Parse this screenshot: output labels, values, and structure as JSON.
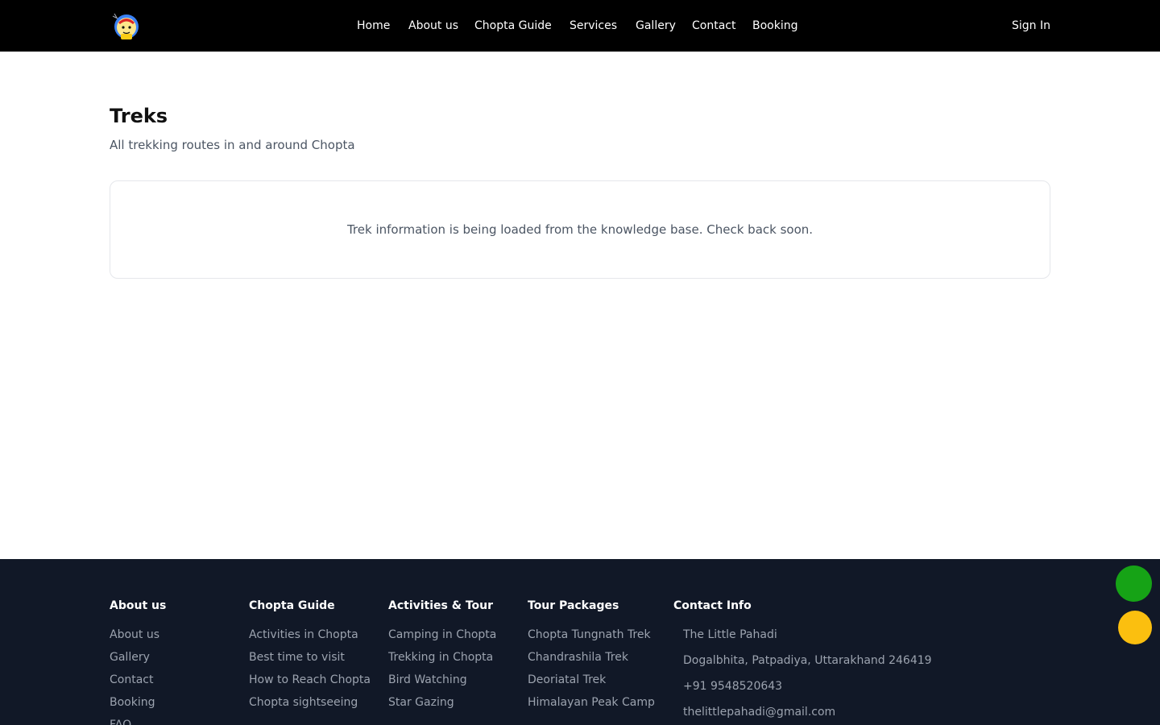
{
  "header": {
    "nav": [
      {
        "label": "Home"
      },
      {
        "label": "About us"
      },
      {
        "label": "Chopta Guide"
      },
      {
        "label": "Services"
      },
      {
        "label": "Gallery"
      },
      {
        "label": "Contact"
      },
      {
        "label": "Booking"
      }
    ],
    "signin_label": "Sign In"
  },
  "main": {
    "title": "Treks",
    "subtitle": "All trekking routes in and around Chopta",
    "notice": "Trek information is being loaded from the knowledge base. Check back soon."
  },
  "footer": {
    "columns": [
      {
        "title": "About us",
        "links": [
          "About us",
          "Gallery",
          "Contact",
          "Booking",
          "FAQ"
        ]
      },
      {
        "title": "Chopta Guide",
        "links": [
          "Activities in Chopta",
          "Best time to visit",
          "How to Reach Chopta",
          "Chopta sightseeing"
        ]
      },
      {
        "title": "Activities & Tour",
        "links": [
          "Camping in Chopta",
          "Trekking in Chopta",
          "Bird Watching",
          "Star Gazing"
        ]
      },
      {
        "title": "Tour Packages",
        "links": [
          "Chopta Tungnath Trek",
          "Chandrashila Trek",
          "Deoriatal Trek",
          "Himalayan Peak Camp"
        ]
      }
    ],
    "contact": {
      "title": "Contact Info",
      "name": "The Little Pahadi",
      "address": "Dogalbhita, Patpadiya, Uttarakhand 246419",
      "phone": "+91 9548520643",
      "email": "thelittlepahadi@gmail.com"
    }
  },
  "colors": {
    "header_bg": "#000000",
    "footer_bg": "#111827",
    "fab_green": "#16a316",
    "fab_yellow": "#fbbf0f"
  },
  "icons": {
    "logo": "pahadi-mascot-logo",
    "fab_green": "green-circle-button",
    "fab_yellow": "yellow-circle-button"
  }
}
